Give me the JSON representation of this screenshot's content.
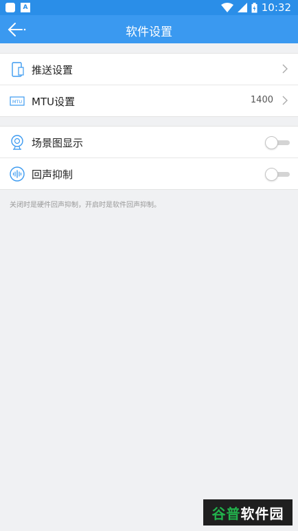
{
  "status_bar": {
    "time": "10:32"
  },
  "header": {
    "title": "软件设置"
  },
  "groups": [
    {
      "items": [
        {
          "label": "推送设置",
          "value": ""
        },
        {
          "label": "MTU设置",
          "value": "1400"
        }
      ]
    },
    {
      "items": [
        {
          "label": "场景图显示",
          "enabled": false
        },
        {
          "label": "回声抑制",
          "enabled": false
        }
      ]
    }
  ],
  "note": "关闭时是硬件回声抑制，开启时是软件回声抑制。",
  "watermark": {
    "part1": "谷普",
    "part2": "软件园"
  },
  "colors": {
    "title_bar": "#3a99f0",
    "status_bar": "#2a8ee8",
    "icon_blue": "#3a99f0"
  }
}
